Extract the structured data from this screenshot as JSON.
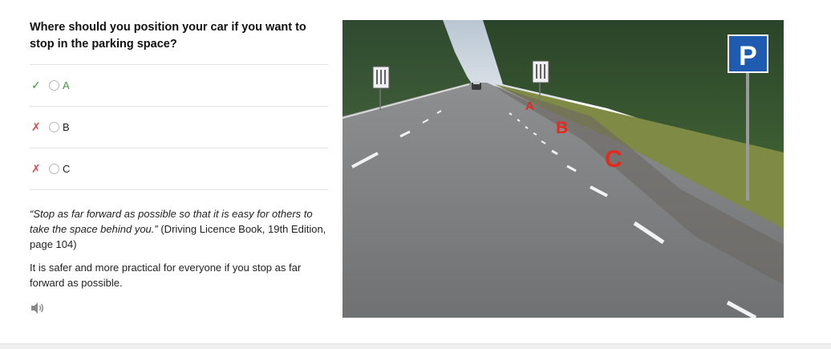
{
  "question": "Where should you position your car if you want to stop in the parking space?",
  "options": [
    {
      "label": "A",
      "status": "correct",
      "mark": "✓"
    },
    {
      "label": "B",
      "status": "wrong",
      "mark": "✗"
    },
    {
      "label": "C",
      "status": "wrong",
      "mark": "✗"
    }
  ],
  "explanation": {
    "quote_open": "“",
    "quote": "Stop as far forward as possible so that it is easy for others to take the space behind you.",
    "quote_close": "”",
    "source": " (Driving Licence Book, 19th Edition, page 104)",
    "text": "It is safer and more practical for everyone if you stop as far forward as possible."
  },
  "photo": {
    "parking_sign": "P",
    "marker_a": "A",
    "marker_b": "B",
    "marker_c": "C"
  },
  "colors": {
    "correct": "#3c9a3c",
    "wrong": "#e04848",
    "marker": "#e8281c",
    "parking_sign_bg": "#1f5bb0"
  }
}
